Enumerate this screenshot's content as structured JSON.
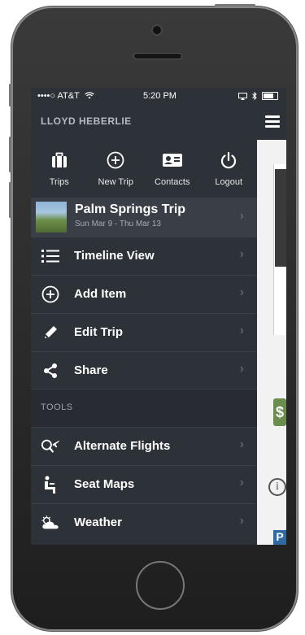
{
  "status_bar": {
    "carrier": "••••○ AT&T",
    "time": "5:20 PM"
  },
  "menu": {
    "user_name": "LLOYD HEBERLIE",
    "quick_actions": [
      {
        "label": "Trips",
        "icon": "suitcase-icon"
      },
      {
        "label": "New Trip",
        "icon": "plus-circle-icon"
      },
      {
        "label": "Contacts",
        "icon": "contact-card-icon"
      },
      {
        "label": "Logout",
        "icon": "power-icon"
      }
    ],
    "current_trip": {
      "title": "Palm Springs Trip",
      "dates": "Sun Mar 9 - Thu Mar 13"
    },
    "trip_items": [
      {
        "label": "Timeline View",
        "icon": "list-icon"
      },
      {
        "label": "Add Item",
        "icon": "plus-circle-icon"
      },
      {
        "label": "Edit Trip",
        "icon": "pencil-icon"
      },
      {
        "label": "Share",
        "icon": "share-icon"
      }
    ],
    "tools_header": "TOOLS",
    "tool_items": [
      {
        "label": "Alternate Flights",
        "icon": "flight-search-icon"
      },
      {
        "label": "Seat Maps",
        "icon": "seat-icon"
      },
      {
        "label": "Weather",
        "icon": "weather-icon"
      }
    ]
  },
  "colors": {
    "menu_bg": "#2d3138",
    "selected_row": "#3a3f47",
    "section_bg": "#282b31"
  }
}
